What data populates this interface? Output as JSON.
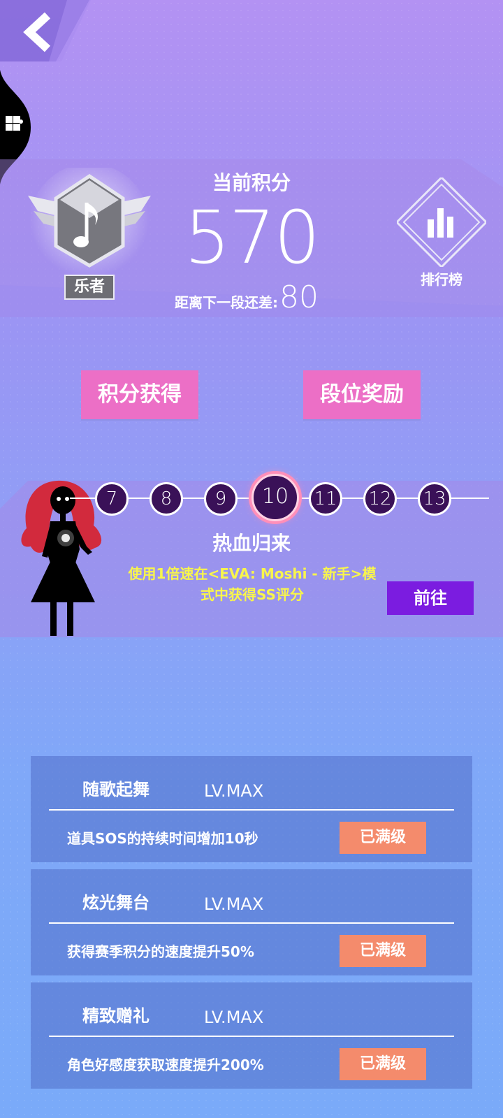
{
  "score": {
    "title": "当前积分",
    "value": "570",
    "next_label": "距离下一段还差:",
    "next_value": "80"
  },
  "rank": {
    "name": "乐者",
    "icon": "music-note-badge-icon"
  },
  "leaderboard": {
    "label": "排行榜",
    "icon": "bar-chart-icon"
  },
  "buttons": {
    "earn_points": "积分获得",
    "tier_rewards": "段位奖励"
  },
  "stages": [
    "7",
    "8",
    "9",
    "10",
    "11",
    "12",
    "13"
  ],
  "current_stage": "10",
  "task": {
    "title": "热血归来",
    "description_line1": "使用1倍速在<EVA: Moshi - 新手>模",
    "description_line2": "式中获得SS评分",
    "goto_label": "前往"
  },
  "skills": [
    {
      "name": "随歌起舞",
      "level": "LV.MAX",
      "description": "道具SOS的持续时间增加10秒",
      "status": "已满级"
    },
    {
      "name": "炫光舞台",
      "level": "LV.MAX",
      "description": "获得赛季积分的速度提升50%",
      "status": "已满级"
    },
    {
      "name": "精致赠礼",
      "level": "LV.MAX",
      "description": "角色好感度获取速度提升200%",
      "status": "已满级"
    }
  ],
  "colors": {
    "pink_button": "#ec6fc6",
    "goto_button": "#7b1ce0",
    "maxed_button": "#f48b6c",
    "task_text": "#f8f54c",
    "stage_node": "#3a1158"
  }
}
